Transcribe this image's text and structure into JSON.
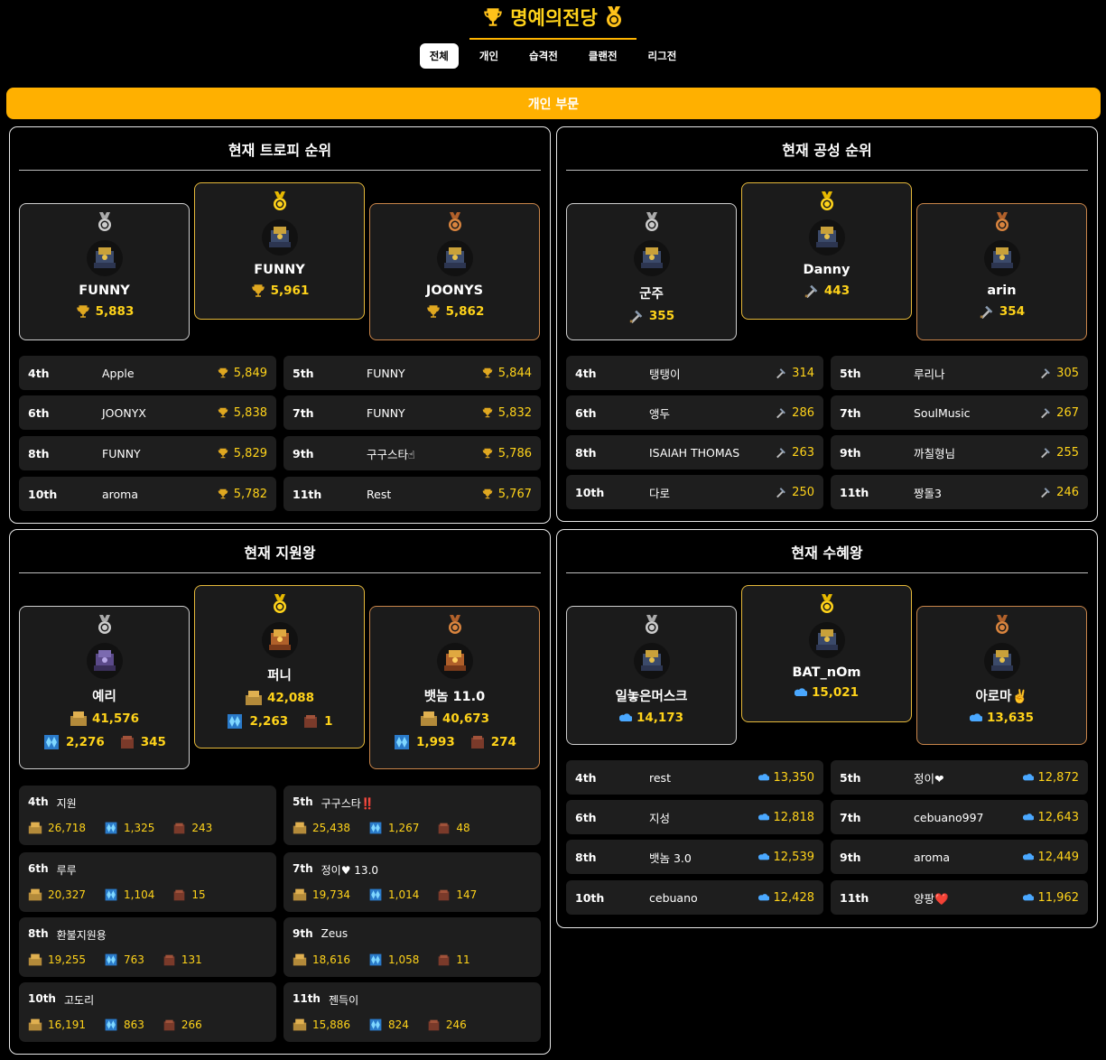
{
  "header": {
    "title": "명예의전당"
  },
  "tabs": [
    {
      "label": "전체",
      "active": true
    },
    {
      "label": "개인"
    },
    {
      "label": "습격전"
    },
    {
      "label": "클랜전"
    },
    {
      "label": "리그전"
    }
  ],
  "section_label": "개인 부문",
  "trophy": {
    "title": "현재 트로피 순위",
    "podium": {
      "second": {
        "name": "FUNNY",
        "value": "5,883"
      },
      "first": {
        "name": "FUNNY",
        "value": "5,961"
      },
      "third": {
        "name": "JOONYS",
        "value": "5,862"
      }
    },
    "rows": [
      {
        "rank": "4th",
        "name": "Apple",
        "value": "5,849"
      },
      {
        "rank": "5th",
        "name": "FUNNY",
        "value": "5,844"
      },
      {
        "rank": "6th",
        "name": "JOONYX",
        "value": "5,838"
      },
      {
        "rank": "7th",
        "name": "FUNNY",
        "value": "5,832"
      },
      {
        "rank": "8th",
        "name": "FUNNY",
        "value": "5,829"
      },
      {
        "rank": "9th",
        "name": "구구스타☝",
        "value": "5,786"
      },
      {
        "rank": "10th",
        "name": "aroma",
        "value": "5,782"
      },
      {
        "rank": "11th",
        "name": "Rest",
        "value": "5,767"
      }
    ]
  },
  "attack": {
    "title": "현재 공성 순위",
    "podium": {
      "second": {
        "name": "군주",
        "value": "355"
      },
      "first": {
        "name": "Danny",
        "value": "443"
      },
      "third": {
        "name": "arin",
        "value": "354"
      }
    },
    "rows": [
      {
        "rank": "4th",
        "name": "탱탱이",
        "value": "314"
      },
      {
        "rank": "5th",
        "name": "루리나",
        "value": "305"
      },
      {
        "rank": "6th",
        "name": "앵두",
        "value": "286"
      },
      {
        "rank": "7th",
        "name": "SoulMusic",
        "value": "267"
      },
      {
        "rank": "8th",
        "name": "ISAIAH THOMAS",
        "value": "263"
      },
      {
        "rank": "9th",
        "name": "까칠형님",
        "value": "255"
      },
      {
        "rank": "10th",
        "name": "다로",
        "value": "250"
      },
      {
        "rank": "11th",
        "name": "짱돌3",
        "value": "246"
      }
    ]
  },
  "donation": {
    "title": "현재 지원왕",
    "podium": {
      "second": {
        "name": "예리",
        "troops": "41,576",
        "spells": "2,276",
        "siege": "345"
      },
      "first": {
        "name": "퍼니",
        "troops": "42,088",
        "spells": "2,263",
        "siege": "1"
      },
      "third": {
        "name": "뱃놈 11.0",
        "troops": "40,673",
        "spells": "1,993",
        "siege": "274"
      }
    },
    "rows": [
      {
        "rank": "4th",
        "name": "지원",
        "troops": "26,718",
        "spells": "1,325",
        "siege": "243"
      },
      {
        "rank": "5th",
        "name": "구구스타‼️",
        "troops": "25,438",
        "spells": "1,267",
        "siege": "48"
      },
      {
        "rank": "6th",
        "name": "루루",
        "troops": "20,327",
        "spells": "1,104",
        "siege": "15"
      },
      {
        "rank": "7th",
        "name": "정이♥ 13.0",
        "troops": "19,734",
        "spells": "1,014",
        "siege": "147"
      },
      {
        "rank": "8th",
        "name": "환불지원용",
        "troops": "19,255",
        "spells": "763",
        "siege": "131"
      },
      {
        "rank": "9th",
        "name": "Zeus",
        "troops": "18,616",
        "spells": "1,058",
        "siege": "11"
      },
      {
        "rank": "10th",
        "name": "고도리",
        "troops": "16,191",
        "spells": "863",
        "siege": "266"
      },
      {
        "rank": "11th",
        "name": "젠득이",
        "troops": "15,886",
        "spells": "824",
        "siege": "246"
      }
    ]
  },
  "received": {
    "title": "현재 수혜왕",
    "podium": {
      "second": {
        "name": "일놓은머스크",
        "value": "14,173"
      },
      "first": {
        "name": "BAT_nOm",
        "value": "15,021"
      },
      "third": {
        "name": "아로마✌️",
        "value": "13,635"
      }
    },
    "rows": [
      {
        "rank": "4th",
        "name": "rest",
        "value": "13,350"
      },
      {
        "rank": "5th",
        "name": "정이❤",
        "value": "12,872"
      },
      {
        "rank": "6th",
        "name": "지성",
        "value": "12,818"
      },
      {
        "rank": "7th",
        "name": "cebuano997",
        "value": "12,643"
      },
      {
        "rank": "8th",
        "name": "뱃놈 3.0",
        "value": "12,539"
      },
      {
        "rank": "9th",
        "name": "aroma",
        "value": "12,449"
      },
      {
        "rank": "10th",
        "name": "cebuano",
        "value": "12,428"
      },
      {
        "rank": "11th",
        "name": "양팡❤️",
        "value": "11,962"
      }
    ]
  },
  "colors": {
    "accent": "#ffb000",
    "gold_text": "#ffd31a",
    "card_bg": "#1b1b1b"
  }
}
